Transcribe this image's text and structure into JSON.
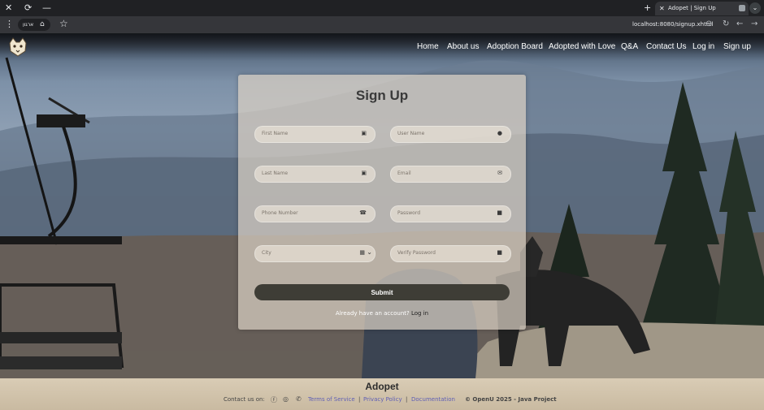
{
  "browser": {
    "tab_title": "Adopet | Sign Up",
    "url": "localhost:8080/signup.xhtml",
    "chip_text": "ארגון"
  },
  "nav": {
    "items": [
      "Home",
      "About us",
      "Adoption Board",
      "Adopted with Love",
      "Q&A",
      "Contact Us",
      "Log in",
      "Sign up"
    ]
  },
  "form": {
    "title": "Sign Up",
    "fields": {
      "first_name": "First Name",
      "user_name": "User Name",
      "last_name": "Last Name",
      "email": "Email",
      "phone": "Phone Number",
      "password": "Password",
      "city": "City",
      "verify_password": "Verify Password"
    },
    "submit_label": "Submit",
    "already_text": "Already have an account?",
    "login_link": "Log in"
  },
  "footer": {
    "title": "Adopet",
    "contact_label": "Contact us on:",
    "links": [
      "Terms of Service",
      "Privacy Policy",
      "Documentation"
    ],
    "copyright": "© OpenU 2025 - Java Project"
  }
}
